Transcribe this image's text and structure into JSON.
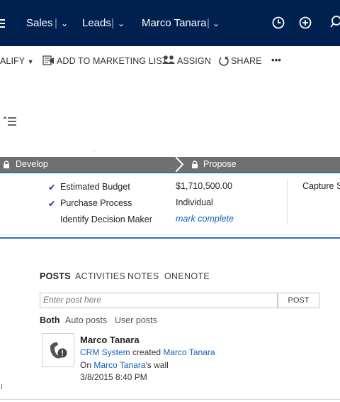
{
  "topnav": {
    "area": "Sales",
    "entity": "Leads",
    "record": "Marco Tanara",
    "colors": {
      "background": "#002050"
    }
  },
  "cmdbar": {
    "qualify_partial": "ALIFY",
    "add_to_marketing_list": "ADD TO MARKETING LIST",
    "assign": "ASSIGN",
    "share": "SHARE",
    "more": "•••"
  },
  "stages": {
    "develop": "Develop",
    "propose": "Propose",
    "steps": [
      {
        "label": "Estimated Budget",
        "value": "$1,710,500.00",
        "checked": true
      },
      {
        "label": "Purchase Process",
        "value": "Individual",
        "checked": true
      },
      {
        "label": "Identify Decision Maker",
        "value": "mark complete",
        "checked": false
      }
    ],
    "next_step_partial": "Capture S"
  },
  "social": {
    "tabs": [
      "POSTS",
      "ACTIVITIES",
      "NOTES",
      "ONENOTE"
    ],
    "post_placeholder": "Enter post here",
    "post_button": "POST",
    "filters": [
      "Both",
      "Auto posts",
      "User posts"
    ],
    "post": {
      "author": "Marco Tanara",
      "creator": "CRM System",
      "created_word": "created",
      "target": "Marco Tanara",
      "on_word": "On",
      "wall_owner": "Marco Tanara",
      "wall_suffix": "'s wall",
      "timestamp": "3/8/2015 8:40 PM"
    }
  }
}
